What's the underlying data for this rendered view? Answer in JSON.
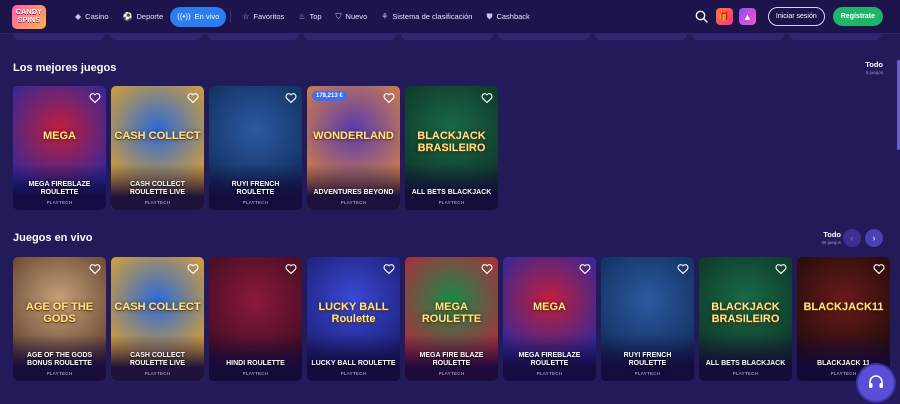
{
  "brand": {
    "line1": "CANDY",
    "line2": "SPINS"
  },
  "nav": [
    {
      "label": "Casino",
      "icon": "diamond-icon"
    },
    {
      "label": "Deporte",
      "icon": "ball-icon"
    },
    {
      "label": "En vivo",
      "icon": "live-icon",
      "active": true
    },
    {
      "label": "Favoritos",
      "icon": "star-icon"
    },
    {
      "label": "Top",
      "icon": "flame-icon"
    },
    {
      "label": "Nuevo",
      "icon": "tag-icon"
    },
    {
      "label": "Sistema de clasificación",
      "icon": "ranking-icon"
    },
    {
      "label": "Cashback",
      "icon": "cashback-icon"
    }
  ],
  "header": {
    "login_label": "Iniciar sesión",
    "register_label": "Regístrate"
  },
  "sections": {
    "best": {
      "title": "Los mejores juegos",
      "see_all": "Todo",
      "count": "5 juegos",
      "cards": [
        {
          "name": "MEGA FIREBLAZE ROULETTE",
          "provider": "PLAYTECH",
          "art": "MEGA",
          "colors": [
            "#c21e3a",
            "#1a2aa8"
          ]
        },
        {
          "name": "CASH COLLECT ROULETTE LIVE",
          "provider": "PLAYTECH",
          "art": "CASH COLLECT",
          "colors": [
            "#2a6ad8",
            "#f2a81e"
          ]
        },
        {
          "name": "RUYI FRENCH ROULETTE",
          "provider": "PLAYTECH",
          "art": "",
          "colors": [
            "#2c5aa0",
            "#0e2a56"
          ]
        },
        {
          "name": "ADVENTURES BEYOND",
          "provider": "PLAYTECH",
          "art": "WONDERLAND",
          "badge": "178,213 €",
          "colors": [
            "#5a3ab0",
            "#e08a3a"
          ]
        },
        {
          "name": "ALL BETS BLACKJACK",
          "provider": "PLAYTECH",
          "art": "BLACKJACK BRASILEIRO",
          "colors": [
            "#1a6a48",
            "#0c3024"
          ]
        }
      ]
    },
    "live": {
      "title": "Juegos en vivo",
      "see_all": "Todo",
      "count": "96 juegos",
      "cards": [
        {
          "name": "AGE OF THE GODS BONUS ROULETTE",
          "provider": "PLAYTECH",
          "art": "AGE OF THE GODS",
          "colors": [
            "#c9a27a",
            "#5a3a2a"
          ]
        },
        {
          "name": "CASH COLLECT ROULETTE LIVE",
          "provider": "PLAYTECH",
          "art": "CASH COLLECT",
          "colors": [
            "#2a6ad8",
            "#f2a81e"
          ]
        },
        {
          "name": "HINDI ROULETTE",
          "provider": "PLAYTECH",
          "art": "",
          "colors": [
            "#8a1a3a",
            "#3a0a20"
          ]
        },
        {
          "name": "LUCKY BALL ROULETTE",
          "provider": "PLAYTECH",
          "art": "LUCKY BALL Roulette",
          "colors": [
            "#3a4ad8",
            "#1a1a6a"
          ]
        },
        {
          "name": "MEGA FIRE BLAZE ROULETTE",
          "provider": "PLAYTECH",
          "art": "MEGA ROULETTE",
          "colors": [
            "#1a8a4a",
            "#c21e3a"
          ]
        },
        {
          "name": "MEGA FIREBLAZE ROULETTE",
          "provider": "PLAYTECH",
          "art": "MEGA",
          "colors": [
            "#c21e3a",
            "#1a2aa8"
          ]
        },
        {
          "name": "RUYI FRENCH ROULETTE",
          "provider": "PLAYTECH",
          "art": "",
          "colors": [
            "#2c5aa0",
            "#0e2a56"
          ]
        },
        {
          "name": "ALL BETS BLACKJACK",
          "provider": "PLAYTECH",
          "art": "BLACKJACK BRASILEIRO",
          "colors": [
            "#1a6a48",
            "#0c3024"
          ]
        },
        {
          "name": "BLACKJACK 11",
          "provider": "PLAYTECH",
          "art": "BLACKJACK11",
          "colors": [
            "#6a1a1a",
            "#1a0a0a"
          ]
        }
      ]
    }
  }
}
